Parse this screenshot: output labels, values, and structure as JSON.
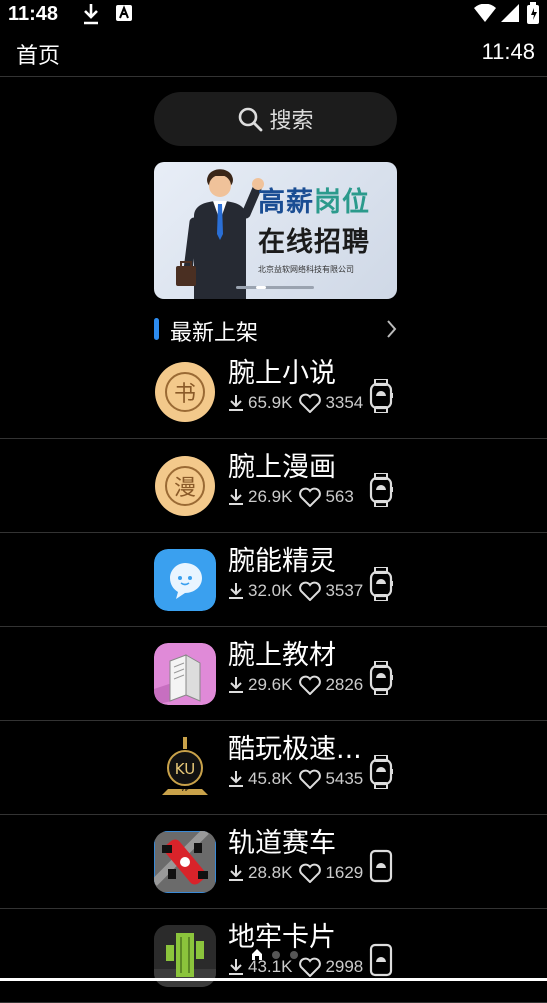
{
  "status_bar": {
    "time": "11:48"
  },
  "header": {
    "title": "首页",
    "time": "11:48"
  },
  "search": {
    "label": "搜索"
  },
  "banner": {
    "line1_a": "高薪",
    "line1_b": "岗位",
    "line2": "在线招聘",
    "company": "北京益软网络科技有限公司"
  },
  "section": {
    "title": "最新上架"
  },
  "apps": [
    {
      "name": "腕上小说",
      "downloads": "65.9K",
      "likes": "3354",
      "icon": "book-coin-icon"
    },
    {
      "name": "腕上漫画",
      "downloads": "26.9K",
      "likes": "563",
      "icon": "manga-coin-icon"
    },
    {
      "name": "腕能精灵",
      "downloads": "32.0K",
      "likes": "3537",
      "icon": "ghost-chat-icon"
    },
    {
      "name": "腕上教材",
      "downloads": "29.6K",
      "likes": "2826",
      "icon": "open-book-icon"
    },
    {
      "name": "酷玩极速...",
      "downloads": "45.8K",
      "likes": "5435",
      "icon": "ku-vip-icon"
    },
    {
      "name": "轨道赛车",
      "downloads": "28.8K",
      "likes": "1629",
      "icon": "race-car-icon"
    },
    {
      "name": "地牢卡片",
      "downloads": "43.1K",
      "likes": "2998",
      "icon": "cactus-pixel-icon"
    }
  ],
  "colors": {
    "background": "#000000",
    "accent": "#2d8cf0",
    "coin": "#f3c98b"
  }
}
